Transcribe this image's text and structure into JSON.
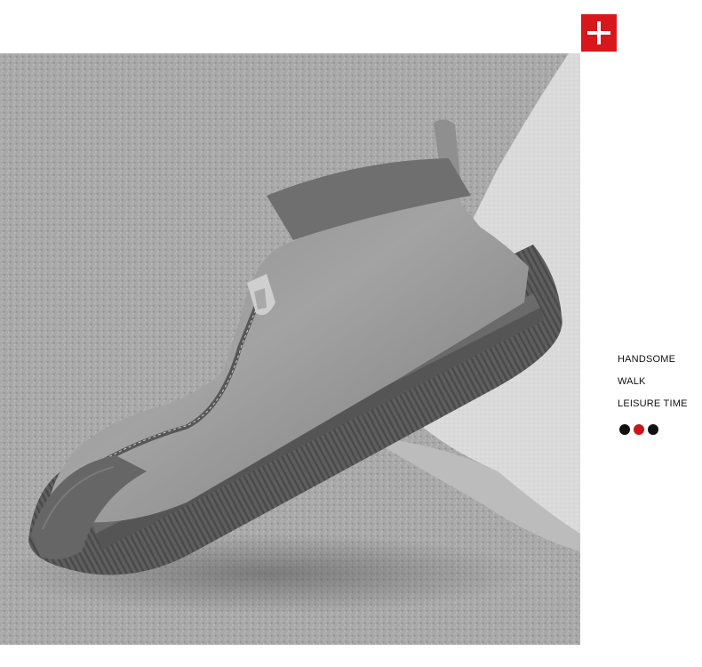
{
  "product_image": {
    "alt": "",
    "badge": {
      "icon": "plus-icon",
      "color": "#d8171d"
    }
  },
  "taglines": [
    "HANDSOME",
    "WALK",
    "LEISURE TIME"
  ],
  "colors": [
    {
      "name": "black",
      "hex": "#111111"
    },
    {
      "name": "red",
      "hex": "#c8161d"
    },
    {
      "name": "black",
      "hex": "#111111"
    }
  ]
}
